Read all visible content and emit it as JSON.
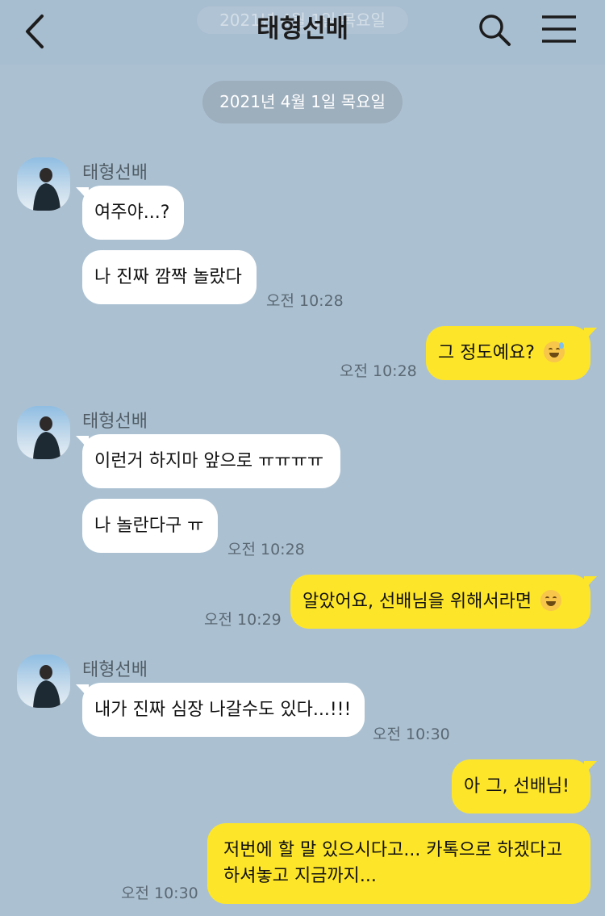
{
  "header": {
    "title": "태형선배",
    "faded_date": "2021년 4월 1일 목요일",
    "back_icon": "chevron-left-icon",
    "search_icon": "search-icon",
    "menu_icon": "hamburger-menu-icon"
  },
  "date_separator": "2021년 4월 1일 목요일",
  "colors": {
    "background": "#abc1d2",
    "outgoing_bubble": "#fde52a",
    "incoming_bubble": "#ffffff"
  },
  "messages": [
    {
      "sender": "태형선배",
      "direction": "in",
      "text": "여주야...?"
    },
    {
      "direction": "in",
      "text": "나 진짜 깜짝 놀랐다",
      "time": "오전 10:28"
    },
    {
      "direction": "out",
      "text": "그 정도예요?",
      "emoji": "grinning-sweat-emoji",
      "time": "오전 10:28"
    },
    {
      "sender": "태형선배",
      "direction": "in",
      "text": "이런거 하지마 앞으로 ㅠㅠㅠㅠ"
    },
    {
      "direction": "in",
      "text": "나 놀란다구 ㅠ",
      "time": "오전 10:28"
    },
    {
      "direction": "out",
      "text": "알았어요, 선배님을 위해서라면",
      "emoji": "smiling-face-emoji",
      "time": "오전 10:29"
    },
    {
      "sender": "태형선배",
      "direction": "in",
      "text": "내가 진짜 심장 나갈수도 있다...!!!",
      "time": "오전 10:30"
    },
    {
      "direction": "out",
      "text": "아 그, 선배님!"
    },
    {
      "direction": "out",
      "text": "저번에 할 말 있으시다고... 카톡으로 하겠다고 하셔놓고 지금까지...",
      "time": "오전 10:30"
    }
  ]
}
